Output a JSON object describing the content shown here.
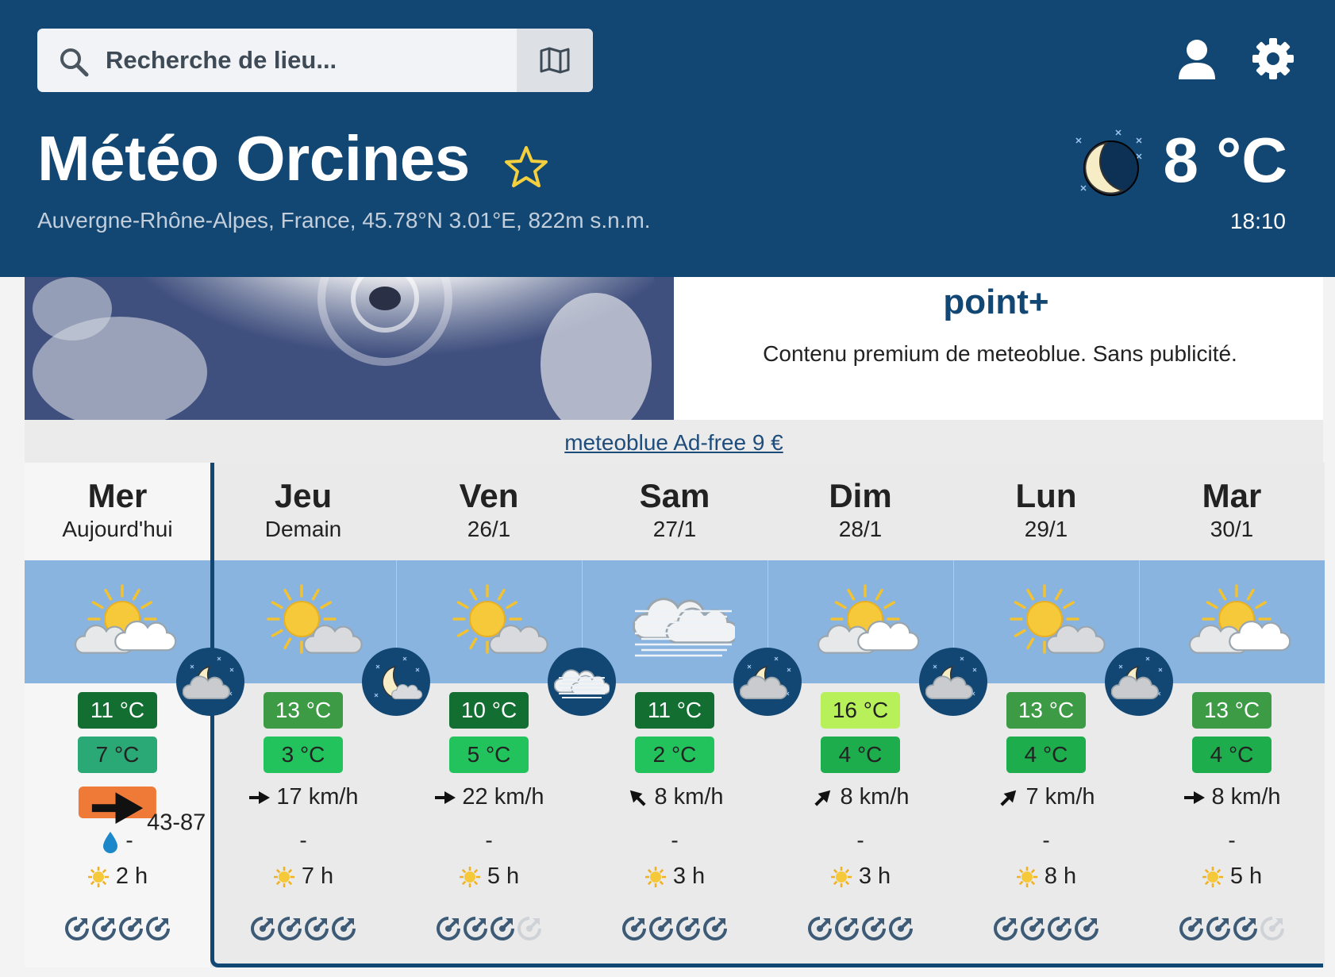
{
  "search": {
    "placeholder": "Recherche de lieu..."
  },
  "location": {
    "title": "Météo Orcines",
    "subtitle": "Auvergne-Rhône-Alpes, France, 45.78°N 3.01°E, 822m s.n.m."
  },
  "current": {
    "temp": "8 °C",
    "time": "18:10",
    "icon": "clear-night-moon-icon"
  },
  "promo": {
    "title": "point+",
    "text": "Contenu premium de meteoblue. Sans publicité.",
    "link": "meteoblue Ad-free 9 €"
  },
  "colors": {
    "header": "#134773",
    "icon_band": "#8ab4e0",
    "gust": "#ef7a38"
  },
  "days": [
    {
      "name": "Mer",
      "date": "Aujourd'hui",
      "icon": "partly-cloudy-icon",
      "tmax": "11 °C",
      "tmax_bg": "#136e31",
      "tmax_fg": "#ffffff",
      "tmin": "7 °C",
      "tmin_bg": "#2aa876",
      "tmin_fg": "#222222",
      "wind": "43-87",
      "wind_dir": 0,
      "gust": true,
      "precip": "-",
      "precip_icon": true,
      "sun": "2 h",
      "predictability": 4
    },
    {
      "name": "Jeu",
      "date": "Demain",
      "icon": "sun-cloud-icon",
      "tmax": "13 °C",
      "tmax_bg": "#3d9a45",
      "tmax_fg": "#ffffff",
      "tmin": "3 °C",
      "tmin_bg": "#22c25c",
      "tmin_fg": "#222222",
      "wind": "17 km/h",
      "wind_dir": 0,
      "gust": false,
      "precip": "-",
      "precip_icon": false,
      "sun": "7 h",
      "predictability": 4
    },
    {
      "name": "Ven",
      "date": "26/1",
      "icon": "sun-cloud-icon",
      "tmax": "10 °C",
      "tmax_bg": "#136e31",
      "tmax_fg": "#ffffff",
      "tmin": "5 °C",
      "tmin_bg": "#22c25c",
      "tmin_fg": "#222222",
      "wind": "22 km/h",
      "wind_dir": 0,
      "gust": false,
      "precip": "-",
      "precip_icon": false,
      "sun": "5 h",
      "predictability": 3
    },
    {
      "name": "Sam",
      "date": "27/1",
      "icon": "fog-cloud-icon",
      "tmax": "11 °C",
      "tmax_bg": "#136e31",
      "tmax_fg": "#ffffff",
      "tmin": "2 °C",
      "tmin_bg": "#22c25c",
      "tmin_fg": "#222222",
      "wind": "8 km/h",
      "wind_dir": 225,
      "gust": false,
      "precip": "-",
      "precip_icon": false,
      "sun": "3 h",
      "predictability": 4
    },
    {
      "name": "Dim",
      "date": "28/1",
      "icon": "partly-cloudy-icon",
      "tmax": "16 °C",
      "tmax_bg": "#b8f05a",
      "tmax_fg": "#222222",
      "tmin": "4 °C",
      "tmin_bg": "#1dad4c",
      "tmin_fg": "#222222",
      "wind": "8 km/h",
      "wind_dir": 315,
      "gust": false,
      "precip": "-",
      "precip_icon": false,
      "sun": "3 h",
      "predictability": 4
    },
    {
      "name": "Lun",
      "date": "29/1",
      "icon": "sun-cloud-icon",
      "tmax": "13 °C",
      "tmax_bg": "#3d9a45",
      "tmax_fg": "#ffffff",
      "tmin": "4 °C",
      "tmin_bg": "#1dad4c",
      "tmin_fg": "#222222",
      "wind": "7 km/h",
      "wind_dir": 315,
      "gust": false,
      "precip": "-",
      "precip_icon": false,
      "sun": "8 h",
      "predictability": 4
    },
    {
      "name": "Mar",
      "date": "30/1",
      "icon": "partly-cloudy-icon",
      "tmax": "13 °C",
      "tmax_bg": "#3d9a45",
      "tmax_fg": "#ffffff",
      "tmin": "4 °C",
      "tmin_bg": "#1dad4c",
      "tmin_fg": "#222222",
      "wind": "8 km/h",
      "wind_dir": 0,
      "gust": false,
      "precip": "-",
      "precip_icon": false,
      "sun": "5 h",
      "predictability": 3
    }
  ],
  "nights": [
    {
      "icon": "night-cloud-moon-icon"
    },
    {
      "icon": "night-moon-small-cloud-icon"
    },
    {
      "icon": "night-fog-icon"
    },
    {
      "icon": "night-cloud-moon-icon"
    },
    {
      "icon": "night-cloud-moon-icon"
    },
    {
      "icon": "night-cloud-moon-icon"
    }
  ]
}
